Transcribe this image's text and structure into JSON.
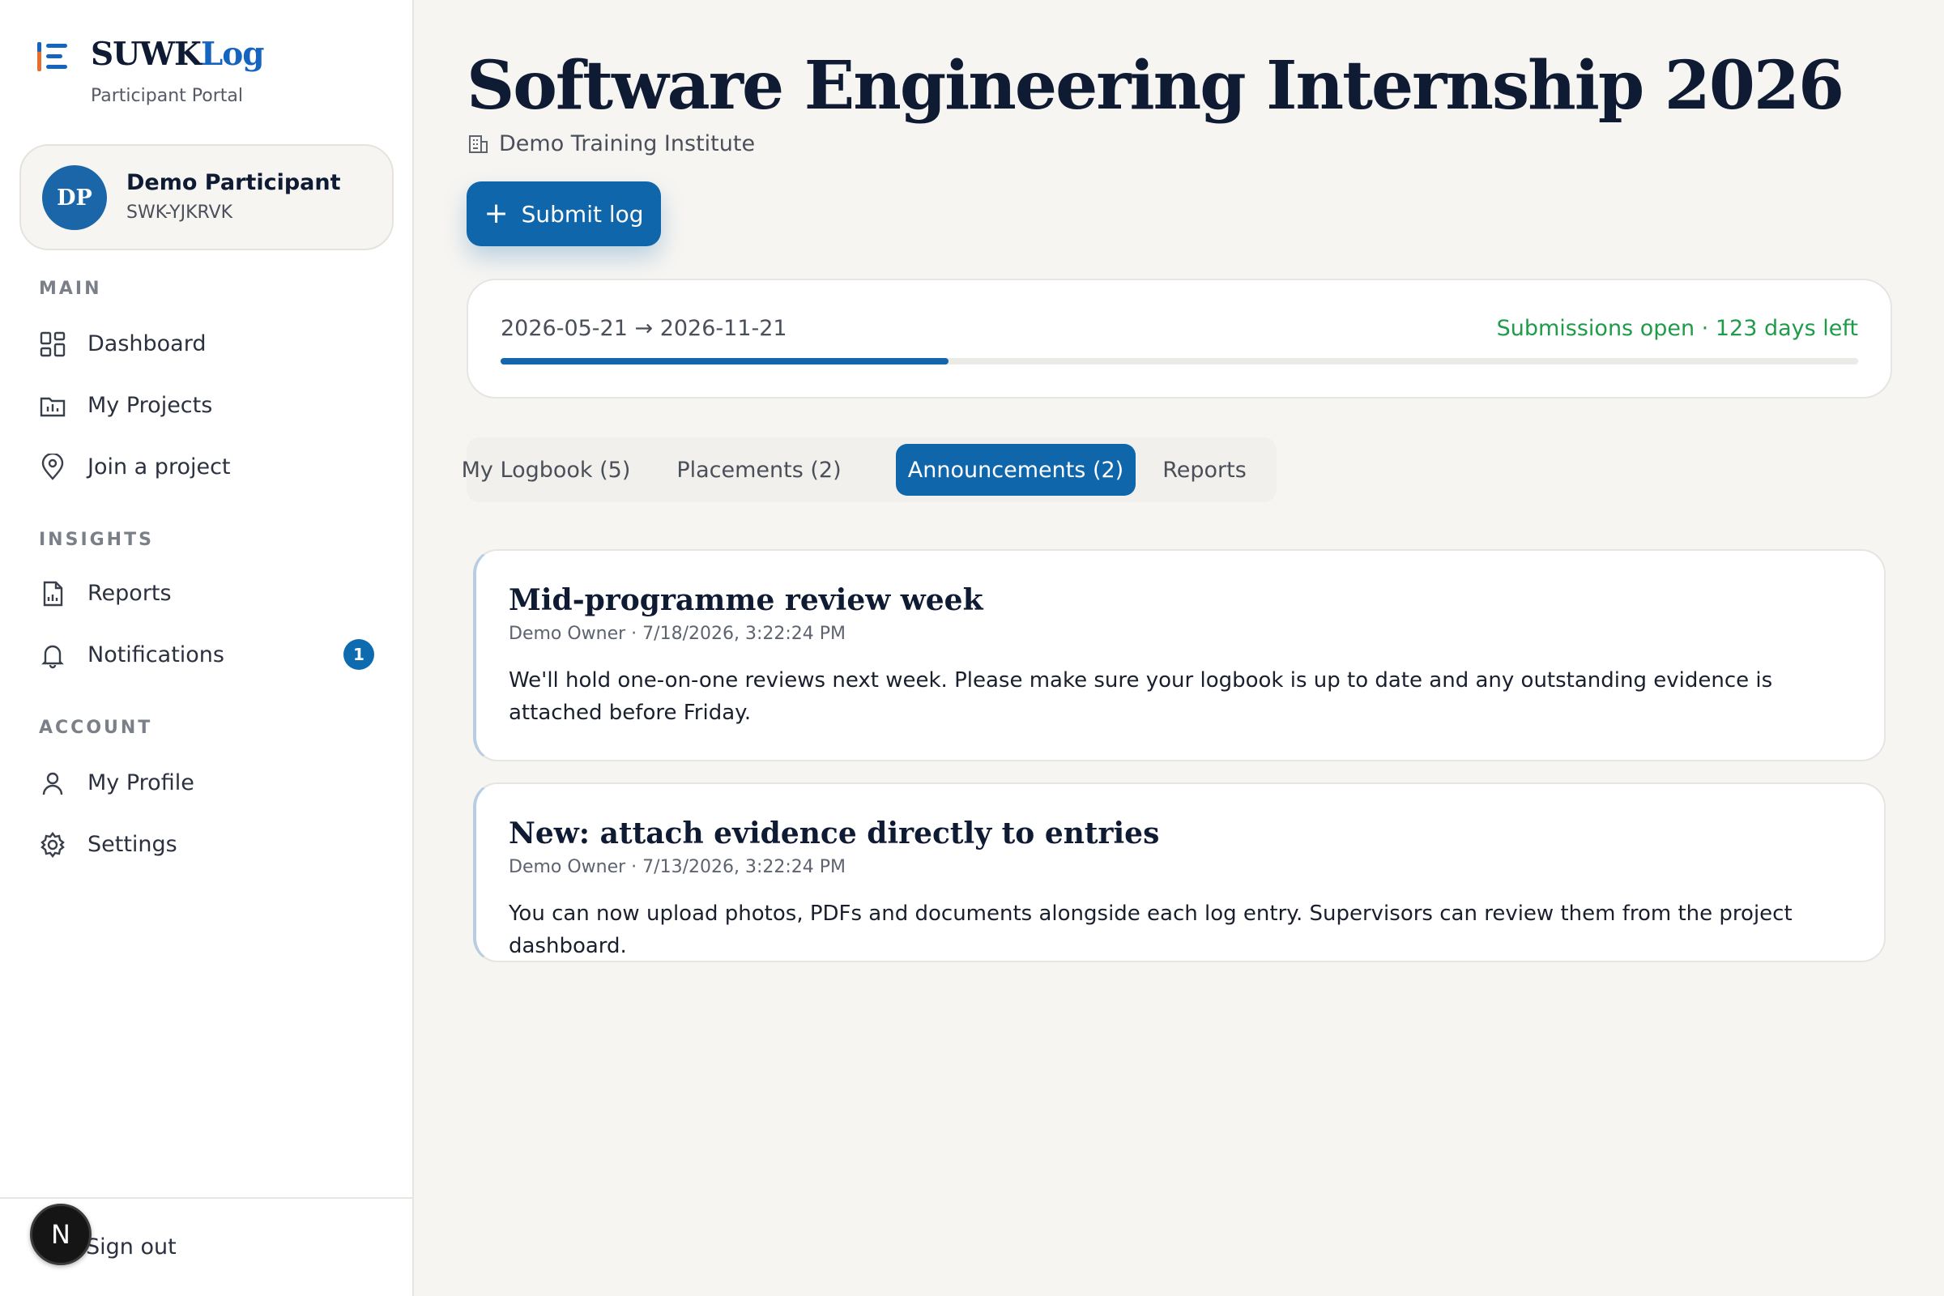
{
  "brand": {
    "name_prefix": "SUWK",
    "name_suffix": "Log",
    "subtitle": "Participant Portal"
  },
  "user": {
    "initials": "DP",
    "name": "Demo Participant",
    "code": "SWK-YJKRVK"
  },
  "nav": {
    "main_label": "MAIN",
    "dashboard": "Dashboard",
    "my_projects": "My Projects",
    "join_project": "Join a project",
    "insights_label": "INSIGHTS",
    "reports": "Reports",
    "notifications": "Notifications",
    "notifications_count": "1",
    "account_label": "ACCOUNT",
    "my_profile": "My Profile",
    "settings": "Settings",
    "sign_out": "Sign out"
  },
  "floating_badge": "N",
  "page": {
    "title": "Software Engineering Internship 2026",
    "org": "Demo Training Institute",
    "submit_label": "Submit log"
  },
  "progress": {
    "dates": "2026-05-21 → 2026-11-21",
    "status": "Submissions open · 123 days left",
    "fraction": 0.33,
    "status_color": "#1f9b4a",
    "accent": "#0f66ab"
  },
  "tabs": [
    {
      "label": "My Logbook (5)"
    },
    {
      "label": "Placements (2)"
    },
    {
      "label": "Announcements (2)",
      "active": true
    },
    {
      "label": "Reports"
    }
  ],
  "announcements": [
    {
      "title": "Mid-programme review week",
      "meta": "Demo Owner · 7/18/2026, 3:22:24 PM",
      "body": "We'll hold one-on-one reviews next week. Please make sure your logbook is up to date and any outstanding evidence is attached before Friday."
    },
    {
      "title": "New: attach evidence directly to entries",
      "meta": "Demo Owner · 7/13/2026, 3:22:24 PM",
      "body": "You can now upload photos, PDFs and documents alongside each log entry. Supervisors can review them from the project dashboard."
    }
  ]
}
